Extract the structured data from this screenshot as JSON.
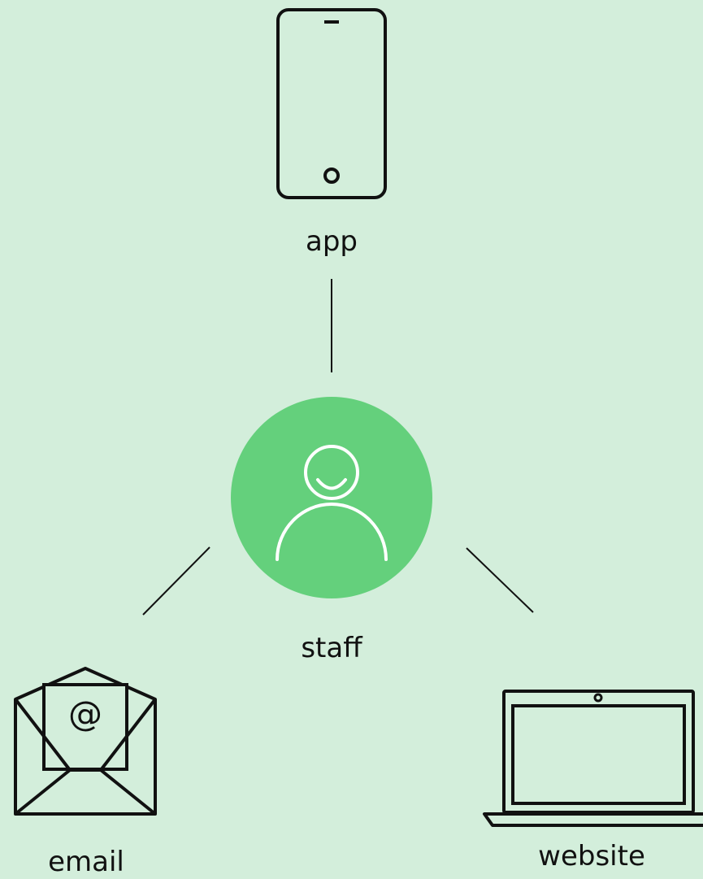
{
  "diagram": {
    "center": {
      "label": "staff",
      "icon": "person-icon"
    },
    "nodes": [
      {
        "id": "app",
        "label": "app",
        "icon": "smartphone-icon"
      },
      {
        "id": "email",
        "label": "email",
        "icon": "email-envelope-icon"
      },
      {
        "id": "website",
        "label": "website",
        "icon": "laptop-icon"
      }
    ]
  },
  "colors": {
    "background": "#d3eedb",
    "center_circle": "#64d07c",
    "line": "#111111",
    "person_stroke": "#ffffff"
  }
}
